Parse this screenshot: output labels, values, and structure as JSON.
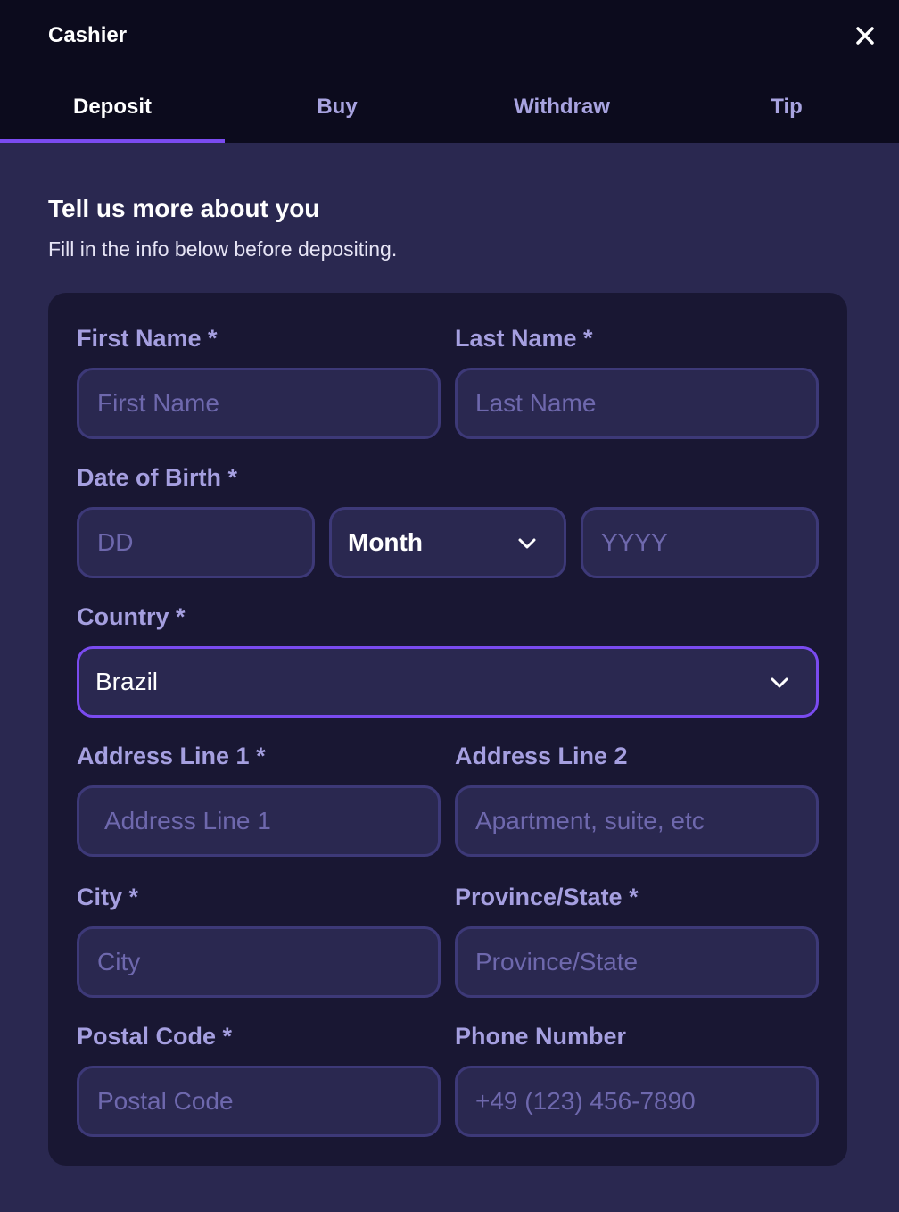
{
  "header": {
    "title": "Cashier"
  },
  "tabs": [
    {
      "label": "Deposit",
      "active": true
    },
    {
      "label": "Buy",
      "active": false
    },
    {
      "label": "Withdraw",
      "active": false
    },
    {
      "label": "Tip",
      "active": false
    }
  ],
  "intro": {
    "heading": "Tell us more about you",
    "subheading": "Fill in the info below before depositing."
  },
  "form": {
    "first_name": {
      "label": "First Name *",
      "placeholder": "First Name"
    },
    "last_name": {
      "label": "Last Name *",
      "placeholder": "Last Name"
    },
    "dob": {
      "label": "Date of Birth *",
      "day_placeholder": "DD",
      "month_value": "Month",
      "year_placeholder": "YYYY"
    },
    "country": {
      "label": "Country *",
      "value": "Brazil"
    },
    "address1": {
      "label": "Address Line 1 *",
      "placeholder": "Address Line 1"
    },
    "address2": {
      "label": "Address Line 2",
      "placeholder": "Apartment, suite, etc"
    },
    "city": {
      "label": "City *",
      "placeholder": "City"
    },
    "province": {
      "label": "Province/State *",
      "placeholder": "Province/State"
    },
    "postal": {
      "label": "Postal Code *",
      "placeholder": "Postal Code"
    },
    "phone": {
      "label": "Phone Number",
      "placeholder": "+49 (123) 456-7890"
    }
  },
  "icons": {
    "close": "close-icon",
    "chevron": "chevron-down-icon"
  },
  "colors": {
    "accent": "#7a4bf0",
    "header_bg": "#0c0b1d",
    "page_bg": "#2a2850",
    "card_bg": "#191733",
    "label": "#a59fe0"
  }
}
